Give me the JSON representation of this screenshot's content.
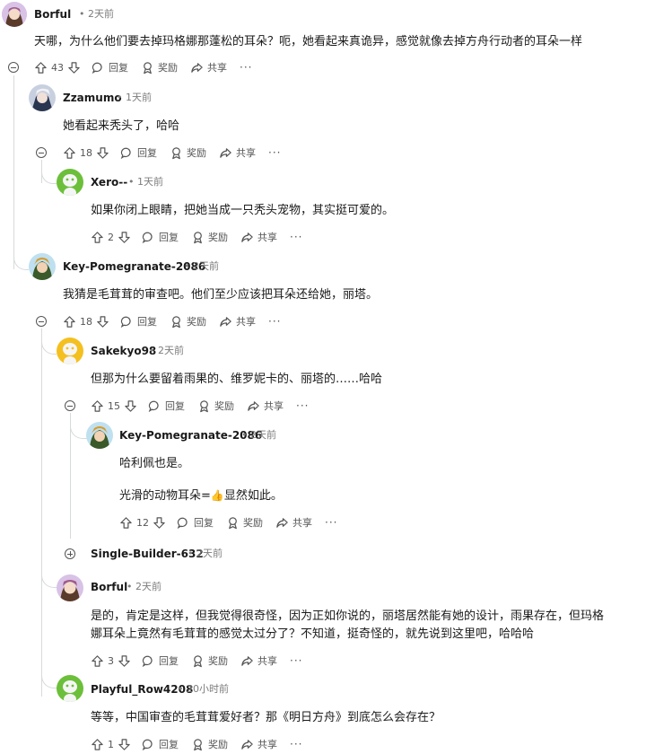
{
  "ui": {
    "reply_label": "回复",
    "award_label": "奖励",
    "share_label": "共享",
    "more_label": "···"
  },
  "comments": [
    {
      "author": "Borful",
      "time": "2天前",
      "text": "天哪，为什么他们要去掉玛格娜那蓬松的耳朵？呃，她看起来真诡异，感觉就像去掉方舟行动者的耳朵一样",
      "votes": "43"
    },
    {
      "author": "Zzamumo",
      "time": "1天前",
      "text": "她看起来秃头了，哈哈",
      "votes": "18"
    },
    {
      "author": "Xero--",
      "time": "1天前",
      "text": "如果你闭上眼睛，把她当成一只秃头宠物，其实挺可爱的。",
      "votes": "2"
    },
    {
      "author": "Key-Pomegranate-2086",
      "time": "2天前",
      "text": "我猜是毛茸茸的审查吧。他们至少应该把耳朵还给她，丽塔。",
      "votes": "18"
    },
    {
      "author": "Sakekyo98",
      "time": "2天前",
      "text": "但那为什么要留着雨果的、维罗妮卡的、丽塔的……哈哈",
      "votes": "15"
    },
    {
      "author": "Key-Pomegranate-2086",
      "time": "2天前",
      "text": "哈利佩也是。",
      "text2_before": "光滑的动物耳朵=",
      "text2_emoji": "👍",
      "text2_after": "显然如此。",
      "votes": "12"
    },
    {
      "author": "Single-Builder-632",
      "time": "2天前"
    },
    {
      "author": "Borful",
      "time": "2天前",
      "text": "是的，肯定是这样，但我觉得很奇怪，因为正如你说的，丽塔居然能有她的设计，雨果存在，但玛格",
      "text_line2": "娜耳朵上竟然有毛茸茸的感觉太过分了？不知道，挺奇怪的，就先说到这里吧，哈哈哈",
      "votes": "3"
    },
    {
      "author": "Playful_Row4208",
      "time": "20小时前",
      "text": "等等，中国审查的毛茸茸爱好者？那《明日方舟》到底怎么会存在？",
      "votes": "1"
    }
  ],
  "colors": {
    "text": "#1a1a1b",
    "meta": "#7c7c7c",
    "thread_line": "#d7dadc",
    "snoo_green": "#6cbf3a",
    "snoo_yellow": "#f4c020"
  }
}
